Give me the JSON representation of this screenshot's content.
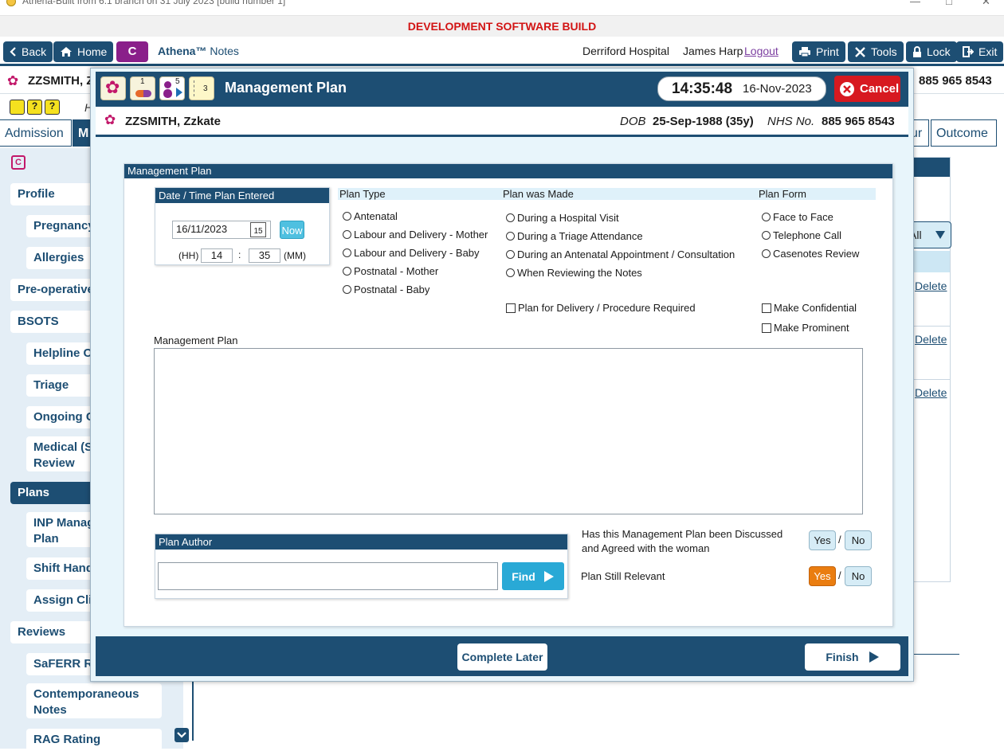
{
  "window": {
    "title": "Athena-Built from 6.1 branch on 31 July 2023 [build number 1]",
    "dev_banner": "DEVELOPMENT SOFTWARE BUILD"
  },
  "topnav": {
    "back": "Back",
    "home": "Home",
    "c_badge": "C",
    "app_name": "Athena™",
    "app_section": "Notes",
    "hospital": "Derriford Hospital",
    "user": "James Harp",
    "logout": "Logout",
    "print": "Print",
    "tools": "Tools",
    "lock": "Lock",
    "exit": "Exit"
  },
  "background": {
    "patient_name": "ZZSMITH, Z",
    "patient_nhs": "885 965 8543",
    "tabs": [
      "Admission",
      "M",
      "ur",
      "Outcome"
    ],
    "sidebar": {
      "c_icon": "C",
      "items": [
        "Profile",
        "Pregnancy",
        "Allergies",
        "Pre-operative",
        "BSOTS",
        "Helpline Co",
        "Triage",
        "Ongoing C",
        "Medical (Sa",
        "Review",
        "Plans",
        "INP Manag",
        "Plan",
        "Shift Hando",
        "Assign Clin",
        "Reviews",
        "SaFERR Rev",
        "Contemporaneous",
        "Notes",
        "RAG Rating"
      ]
    },
    "filter_value": "All",
    "delete_links": [
      "Delete",
      "Delete",
      "Delete"
    ],
    "h_label": "H"
  },
  "modal": {
    "title": "Management Plan",
    "header_icon_badges": [
      "1",
      "5",
      "3"
    ],
    "time": "14:35:48",
    "date": "16-Nov-2023",
    "cancel": "Cancel",
    "patient": {
      "name": "ZZSMITH, Zzkate",
      "dob_label": "DOB",
      "dob_value": "25-Sep-1988 (35y)",
      "nhs_label": "NHS No.",
      "nhs_value": "885 965 8543"
    },
    "section_title": "Management Plan",
    "datetime_panel": {
      "title": "Date / Time Plan Entered",
      "date_value": "16/11/2023",
      "calendar_num": "15",
      "now": "Now",
      "hh_label": "(HH)",
      "hh_value": "14",
      "sep": ":",
      "mm_value": "35",
      "mm_label": "(MM)"
    },
    "plan_type": {
      "header": "Plan Type",
      "options": [
        "Antenatal",
        "Labour and Delivery - Mother",
        "Labour and Delivery - Baby",
        "Postnatal - Mother",
        "Postnatal - Baby"
      ]
    },
    "plan_made": {
      "header": "Plan was Made",
      "options": [
        "During a Hospital Visit",
        "During a Triage Attendance",
        "During an Antenatal Appointment / Consultation",
        "When Reviewing the Notes"
      ],
      "checkbox": "Plan for Delivery / Procedure Required"
    },
    "plan_form": {
      "header": "Plan Form",
      "options": [
        "Face to Face",
        "Telephone Call",
        "Casenotes Review"
      ],
      "checkboxes": [
        "Make Confidential",
        "Make Prominent"
      ]
    },
    "plan_text_label": "Management Plan",
    "plan_text_value": "",
    "author": {
      "title": "Plan Author",
      "value": "",
      "find": "Find"
    },
    "discussed": {
      "question_line1": "Has this Management Plan been Discussed",
      "question_line2": "and Agreed with the woman",
      "yes": "Yes",
      "sep": "/",
      "no": "No",
      "selected": ""
    },
    "relevant": {
      "question": "Plan Still Relevant",
      "yes": "Yes",
      "sep": "/",
      "no": "No",
      "selected": "Yes"
    },
    "footer": {
      "complete_later": "Complete Later",
      "finish": "Finish"
    }
  },
  "colors": {
    "primary_navy": "#1d4e73",
    "accent_cyan": "#29a9d6",
    "cancel_red": "#d71920",
    "selected_orange": "#ea7d10",
    "dev_banner_red": "#d21414"
  }
}
